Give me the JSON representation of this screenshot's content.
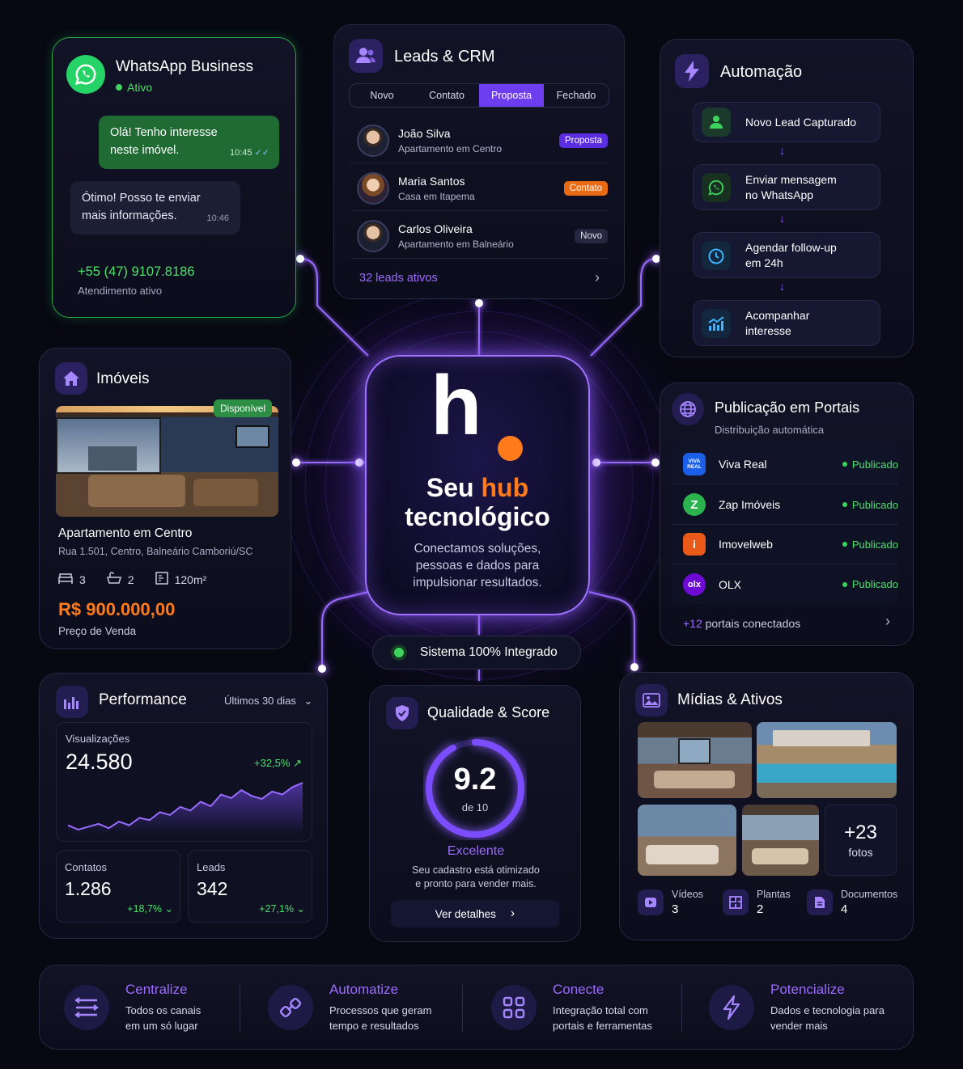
{
  "whatsapp": {
    "title": "WhatsApp Business",
    "status": "Ativo",
    "msg_out": "Olá! Tenho interesse neste imóvel.",
    "msg_out_time": "10:45",
    "msg_in": "Ótimo! Posso te enviar mais informações.",
    "msg_in_time": "10:46",
    "phone": "+55 (47) 9107.8186",
    "phone_status": "Atendimento ativo",
    "accent": "#25d366"
  },
  "crm": {
    "title": "Leads & CRM",
    "tabs": [
      "Novo",
      "Contato",
      "Proposta",
      "Fechado"
    ],
    "leads": [
      {
        "name": "João Silva",
        "sub": "Apartamento em Centro",
        "badge": "Proposta"
      },
      {
        "name": "Maria Santos",
        "sub": "Casa em Itapema",
        "badge": "Contato"
      },
      {
        "name": "Carlos Oliveira",
        "sub": "Apartamento em Balneário",
        "badge": "Novo"
      }
    ],
    "footer": "32 leads ativos"
  },
  "automacao": {
    "title": "Automação",
    "steps": [
      {
        "label": "Novo Lead Capturado"
      },
      {
        "label1": "Enviar mensagem",
        "label2": "no WhatsApp"
      },
      {
        "label1": "Agendar follow-up",
        "label2": "em 24h"
      },
      {
        "label1": "Acompanhar",
        "label2": "interesse"
      }
    ]
  },
  "imoveis": {
    "title": "Imóveis",
    "badge": "Disponível",
    "name": "Apartamento em Centro",
    "address": "Rua 1.501, Centro, Balneário Camboriú/SC",
    "beds": "3",
    "baths": "2",
    "area": "120m²",
    "price": "R$ 900.000,00",
    "price_label": "Preço de Venda"
  },
  "hub": {
    "logo": "h",
    "title_a": "Seu ",
    "title_b": "hub",
    "title_c": "tecnológico",
    "desc1": "Conectamos soluções,",
    "desc2": "pessoas e dados para",
    "desc3": "impulsionar resultados.",
    "status": "Sistema 100% Integrado"
  },
  "portais": {
    "title": "Publicação em Portais",
    "subtitle": "Distribuição automática",
    "items": [
      {
        "name": "Viva Real",
        "status": "Publicado",
        "logo": "VIVA REAL"
      },
      {
        "name": "Zap Imóveis",
        "status": "Publicado",
        "logo": "Z"
      },
      {
        "name": "Imovelweb",
        "status": "Publicado",
        "logo": "i"
      },
      {
        "name": "OLX",
        "status": "Publicado",
        "logo": "olx"
      }
    ],
    "footer_count": "+12",
    "footer_text": " portais conectados"
  },
  "performance": {
    "title": "Performance",
    "period": "Últimos 30 dias",
    "views_label": "Visualizações",
    "views": "24.580",
    "views_delta": "+32,5%",
    "contacts_label": "Contatos",
    "contacts": "1.286",
    "contacts_delta": "+18,7%",
    "leads_label": "Leads",
    "leads": "342",
    "leads_delta": "+27,1%",
    "sparkline": [
      20,
      14,
      18,
      22,
      16,
      25,
      20,
      30,
      27,
      38,
      34,
      45,
      40,
      52,
      46,
      62,
      57,
      68,
      60,
      56,
      66,
      62,
      72,
      78
    ]
  },
  "score": {
    "title": "Qualidade & Score",
    "value": "9.2",
    "of": "de 10",
    "fraction": 0.92,
    "label": "Excelente",
    "desc1": "Seu cadastro está otimizado",
    "desc2": "e pronto para vender mais.",
    "button": "Ver detalhes"
  },
  "midias": {
    "title": "Mídias & Ativos",
    "more": "+23",
    "more_label": "fotos",
    "stats": [
      {
        "label": "Vídeos",
        "value": "3"
      },
      {
        "label": "Plantas",
        "value": "2"
      },
      {
        "label": "Documentos",
        "value": "4"
      }
    ]
  },
  "features": [
    {
      "title": "Centralize",
      "line1": "Todos os canais",
      "line2": "em um só lugar"
    },
    {
      "title": "Automatize",
      "line1": "Processos que geram",
      "line2": "tempo e resultados"
    },
    {
      "title": "Conecte",
      "line1": "Integração total com",
      "line2": "portais e ferramentas"
    },
    {
      "title": "Potencialize",
      "line1": "Dados e tecnologia para",
      "line2": "vender mais"
    }
  ],
  "colors": {
    "accent": "#7c4dff",
    "orange": "#ff7a1a",
    "green": "#3dd35d"
  }
}
